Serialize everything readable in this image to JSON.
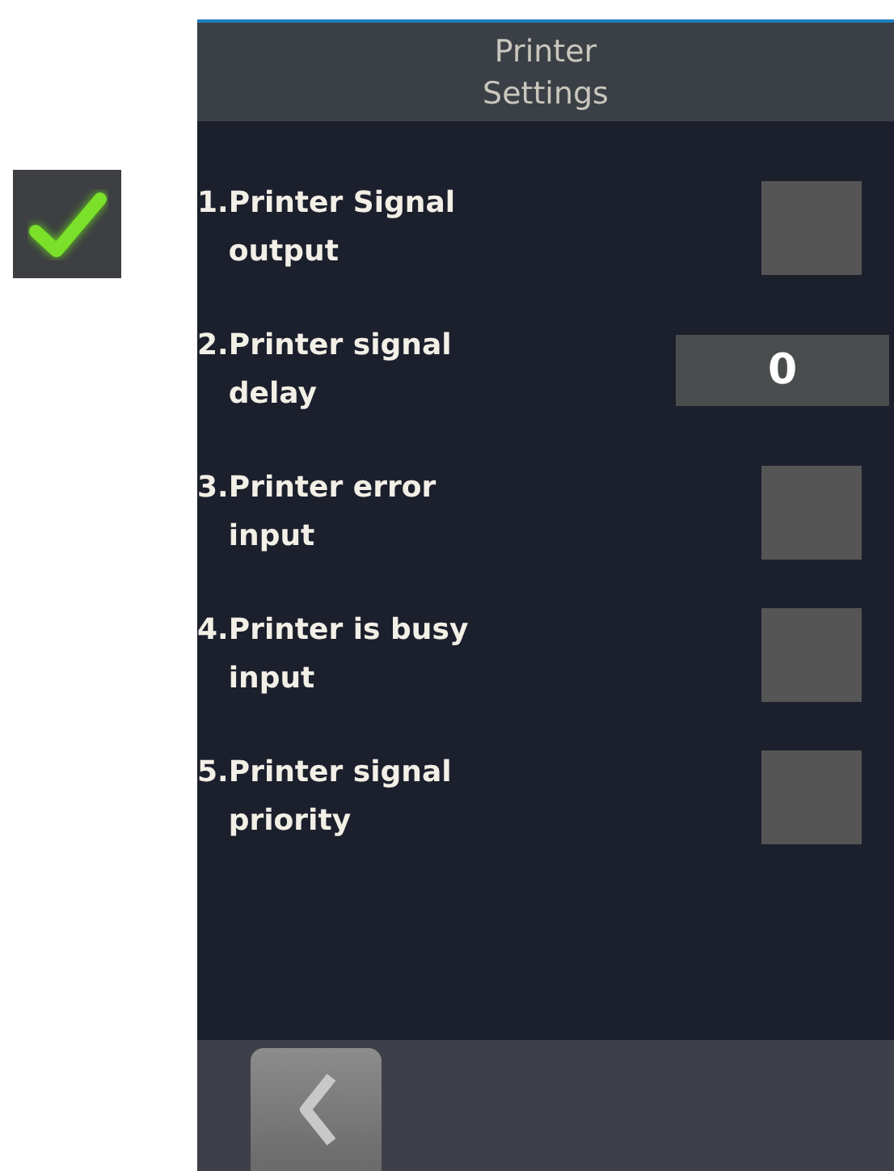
{
  "header": {
    "title": "Printer\nSettings"
  },
  "settings": [
    {
      "number": "1.",
      "label": "Printer Signal\noutput",
      "kind": "checkbox",
      "checked": false
    },
    {
      "number": "2.",
      "label": "Printer signal\ndelay",
      "kind": "number",
      "value": "0"
    },
    {
      "number": "3.",
      "label": "Printer error\ninput",
      "kind": "checkbox",
      "checked": false
    },
    {
      "number": "4.",
      "label": "Printer is busy\ninput",
      "kind": "checkbox",
      "checked": false
    },
    {
      "number": "5.",
      "label": "Printer signal\npriority",
      "kind": "checkbox",
      "checked": false
    }
  ]
}
